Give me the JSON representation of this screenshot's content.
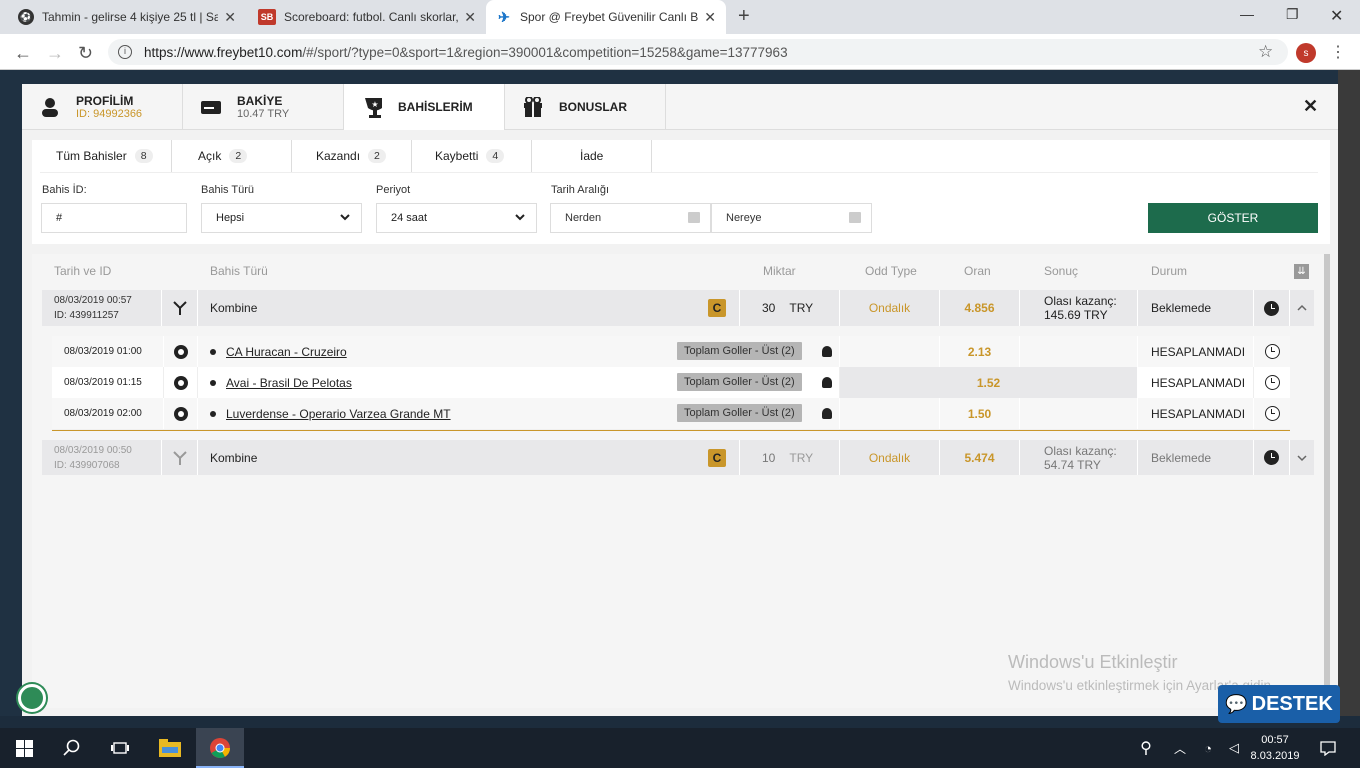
{
  "browser": {
    "tabs": [
      {
        "title": "Tahmin - gelirse 4 kişiye 25 tl | Sa",
        "icon": "soccer-ball-icon"
      },
      {
        "title": "Scoreboard: futbol. Canlı skorlar,",
        "icon": "sb-logo-icon"
      },
      {
        "title": "Spor @ Freybet Güvenilir Canlı B",
        "icon": "freybet-logo-icon"
      }
    ],
    "url_domain": "https://www.freybet10.com",
    "url_path": "/#/sport/?type=0&sport=1&region=390001&competition=15258&game=13777963",
    "avatar_letter": "s"
  },
  "modal": {
    "tabs": [
      {
        "label": "PROFİLİM",
        "sub": "ID: 94992366"
      },
      {
        "label": "BAKİYE",
        "sub": "10.47 TRY"
      },
      {
        "label": "BAHİSLERİM"
      },
      {
        "label": "BONUSLAR"
      }
    ],
    "close": "✕",
    "subtabs": [
      {
        "label": "Tüm Bahisler",
        "count": "8"
      },
      {
        "label": "Açık",
        "count": "2"
      },
      {
        "label": "Kazandı",
        "count": "2"
      },
      {
        "label": "Kaybetti",
        "count": "4"
      },
      {
        "label": "İade"
      }
    ],
    "filters": {
      "bet_id_label": "Bahis İD:",
      "bet_id_value": "#",
      "bet_type_label": "Bahis Türü",
      "bet_type_value": "Hepsi",
      "period_label": "Periyot",
      "period_value": "24 saat",
      "date_range_label": "Tarih Aralığı",
      "from_placeholder": "Nerden",
      "to_placeholder": "Nereye",
      "show_button": "GÖSTER"
    },
    "table": {
      "headers": [
        "Tarih ve ID",
        "Bahis Türü",
        "Miktar",
        "Odd Type",
        "Oran",
        "Sonuç",
        "Durum"
      ],
      "bets": [
        {
          "date": "08/03/2019 00:57",
          "id": "ID: 439911257",
          "type": "Kombine",
          "amount": "30",
          "currency": "TRY",
          "odd_type": "Ondalık",
          "odds": "4.856",
          "result_label": "Olası kazanç:",
          "result_value": "145.69 TRY",
          "status": "Beklemede",
          "events": [
            {
              "date": "08/03/2019 01:00",
              "match": "CA Huracan - Cruzeiro",
              "market": "Toplam Goller - Üst (2)",
              "odds": "2.13",
              "status": "HESAPLANMADI"
            },
            {
              "date": "08/03/2019 01:15",
              "match": "Avai - Brasil De Pelotas",
              "market": "Toplam Goller - Üst (2)",
              "odds": "1.52",
              "status": "HESAPLANMADI"
            },
            {
              "date": "08/03/2019 02:00",
              "match": "Luverdense - Operario Varzea Grande MT",
              "market": "Toplam Goller - Üst (2)",
              "odds": "1.50",
              "status": "HESAPLANMADI"
            }
          ]
        },
        {
          "date": "08/03/2019 00:50",
          "id": "ID: 439907068",
          "type": "Kombine",
          "amount": "10",
          "currency": "TRY",
          "odd_type": "Ondalık",
          "odds": "5.474",
          "result_label": "Olası kazanç:",
          "result_value": "54.74 TRY",
          "status": "Beklemede"
        }
      ]
    }
  },
  "watermark": {
    "line1": "Windows'u Etkinleştir",
    "line2": "Windows'u etkinleştirmek için Ayarlar'a gidin."
  },
  "destek": "DESTEK",
  "taskbar": {
    "time": "00:57",
    "date": "8.03.2019"
  },
  "colors": {
    "accent_gold": "#c9962a",
    "button_green": "#1d6b4c",
    "support_blue": "#1a5fa8"
  }
}
